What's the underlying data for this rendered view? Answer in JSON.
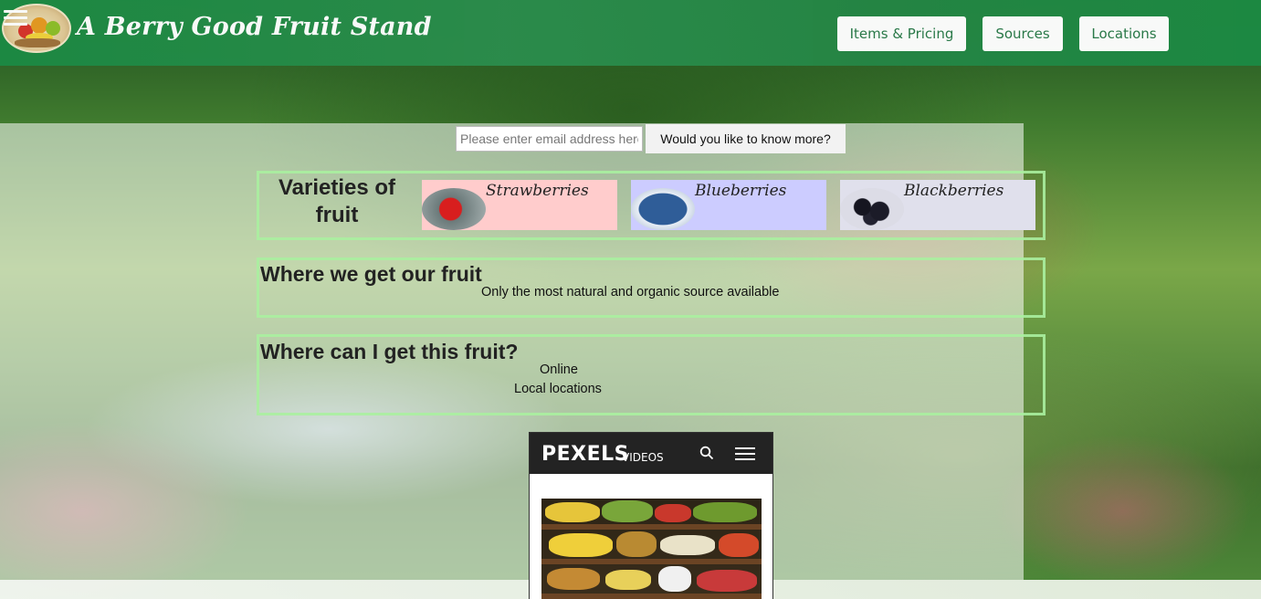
{
  "header": {
    "site_title": "A Berry Good Fruit Stand",
    "nav": [
      {
        "label": "Items & Pricing"
      },
      {
        "label": "Sources"
      },
      {
        "label": "Locations"
      }
    ]
  },
  "subscribe": {
    "email_placeholder": "Please enter email address here",
    "button_label": "Would you like to know more?"
  },
  "varieties": {
    "title": "Varieties of fruit",
    "items": [
      {
        "name": "Strawberries",
        "color": "#ffcccc"
      },
      {
        "name": "Blueberries",
        "color": "#ccccff"
      },
      {
        "name": "Blackberries",
        "color": "#e0e0ec"
      }
    ]
  },
  "sources": {
    "heading": "Where we get our fruit",
    "text": "Only the most natural and organic source available"
  },
  "locations": {
    "heading": "Where can I get this fruit?",
    "lines": [
      "Online",
      "Local locations"
    ]
  },
  "video": {
    "brand": "PEXELS",
    "brand_suffix": "VIDEOS"
  }
}
